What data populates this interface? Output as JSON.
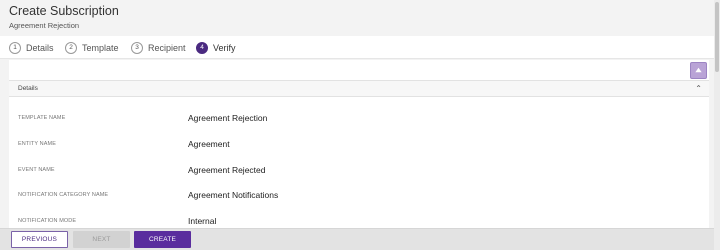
{
  "header": {
    "title": "Create Subscription",
    "subtitle": "Agreement Rejection"
  },
  "steps": [
    {
      "num": "1",
      "label": "Details",
      "active": false
    },
    {
      "num": "2",
      "label": "Template",
      "active": false
    },
    {
      "num": "3",
      "label": "Recipient",
      "active": false
    },
    {
      "num": "4",
      "label": "Verify",
      "active": true
    }
  ],
  "section": {
    "title": "Details",
    "collapse_icon": "chevron-up-icon"
  },
  "details": [
    {
      "key": "TEMPLATE NAME",
      "value": "Agreement Rejection"
    },
    {
      "key": "ENTITY NAME",
      "value": "Agreement"
    },
    {
      "key": "EVENT NAME",
      "value": "Agreement Rejected"
    },
    {
      "key": "NOTIFICATION CATEGORY NAME",
      "value": "Agreement Notifications"
    },
    {
      "key": "NOTIFICATION MODE",
      "value": "Internal"
    }
  ],
  "footer": {
    "previous_label": "PREVIOUS",
    "next_label": "NEXT",
    "create_label": "CREATE"
  },
  "colors": {
    "accent": "#5a2d9e",
    "accent_dark": "#4a2a80",
    "disabled": "#d2d2d2"
  }
}
